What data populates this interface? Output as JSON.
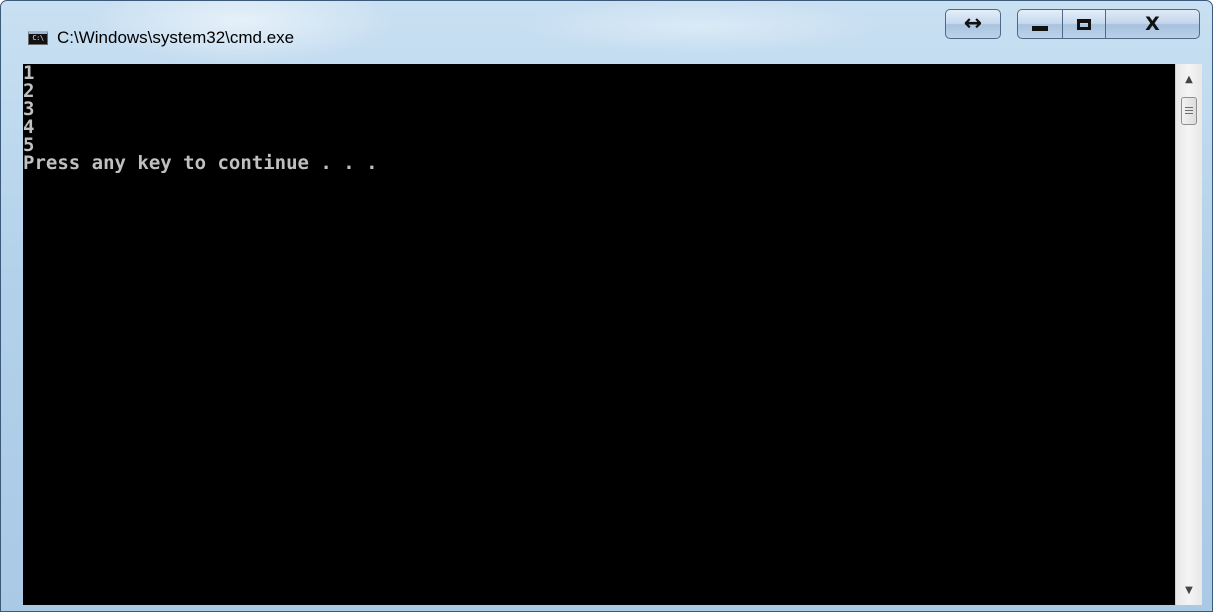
{
  "window": {
    "title": "C:\\Windows\\system32\\cmd.exe",
    "app_icon_label": "C:\\",
    "buttons": {
      "resize_icon": "resize-arrows-icon",
      "minimize_icon": "minimize-icon",
      "maximize_icon": "maximize-icon",
      "close_icon": "close-icon"
    }
  },
  "console": {
    "lines": [
      "1",
      "2",
      "3",
      "4",
      "5",
      "Press any key to continue . . ."
    ],
    "background": "#000000",
    "foreground": "#c0c0c0"
  },
  "scrollbar": {
    "up_arrow": "▲",
    "down_arrow": "▼"
  }
}
